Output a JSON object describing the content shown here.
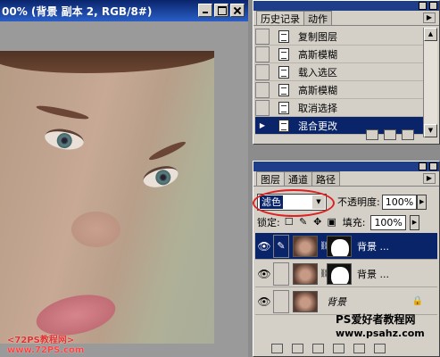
{
  "document": {
    "title": "00% (背景 副本 2, RGB/8#)",
    "watermark_line1": "<72PS教程网>",
    "watermark_line2": "www.72PS.com"
  },
  "history_panel": {
    "tabs": [
      "历史记录",
      "动作"
    ],
    "items": [
      {
        "label": "复制图层"
      },
      {
        "label": "高斯模糊"
      },
      {
        "label": "载入选区"
      },
      {
        "label": "高斯模糊"
      },
      {
        "label": "取消选择"
      },
      {
        "label": "混合更改",
        "selected": true
      }
    ]
  },
  "layers_panel": {
    "tabs": [
      "图层",
      "通道",
      "路径"
    ],
    "blend_mode": "滤色",
    "opacity_label": "不透明度:",
    "opacity_value": "100%",
    "lock_label": "锁定:",
    "fill_label": "填充:",
    "fill_value": "100%",
    "layers": [
      {
        "name": "背景 ...",
        "selected": true
      },
      {
        "name": "背景 ..."
      },
      {
        "name": "背景"
      }
    ],
    "site_watermark": "PS爱好者教程网",
    "site_url": "www.psahz.com"
  },
  "icons": {
    "eye": "eye-icon",
    "brush": "brush-icon",
    "link": "chain-link-icon",
    "lock": "lock-icon"
  },
  "colors": {
    "selection": "#0a246a",
    "panel": "#d4d0c8",
    "annotation_ring": "#e02020"
  }
}
